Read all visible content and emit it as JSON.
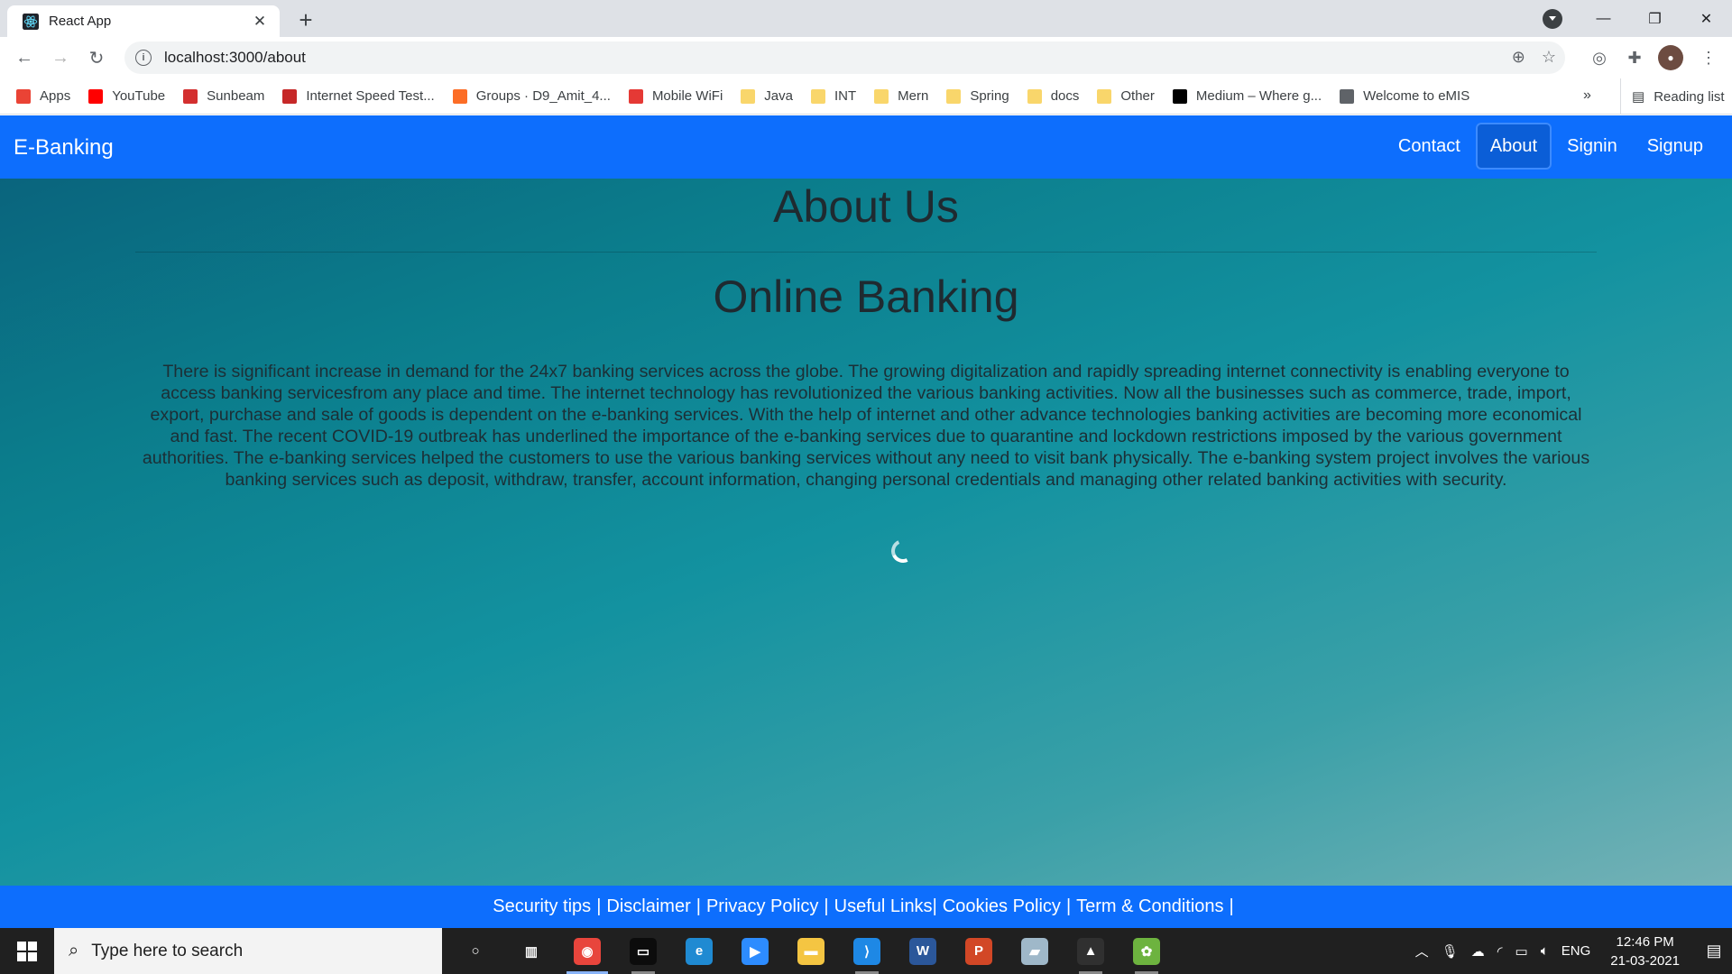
{
  "browser": {
    "tab_title": "React App",
    "url": "localhost:3000/about",
    "bookmarks": [
      {
        "label": "Apps",
        "color": "#ea4335"
      },
      {
        "label": "YouTube",
        "color": "#ff0000"
      },
      {
        "label": "Sunbeam",
        "color": "#d32f2f"
      },
      {
        "label": "Internet Speed Test...",
        "color": "#c62828"
      },
      {
        "label": "Groups · D9_Amit_4...",
        "color": "#fc6d26"
      },
      {
        "label": "Mobile WiFi",
        "color": "#e53935"
      },
      {
        "label": "Java",
        "color": "#f9d66b"
      },
      {
        "label": "INT",
        "color": "#f9d66b"
      },
      {
        "label": "Mern",
        "color": "#f9d66b"
      },
      {
        "label": "Spring",
        "color": "#f9d66b"
      },
      {
        "label": "docs",
        "color": "#f9d66b"
      },
      {
        "label": "Other",
        "color": "#f9d66b"
      },
      {
        "label": "Medium – Where g...",
        "color": "#000000"
      },
      {
        "label": "Welcome to eMIS",
        "color": "#5f6368"
      }
    ],
    "bookmarks_more": "»",
    "reading_list": "Reading list"
  },
  "navbar": {
    "brand": "E-Banking",
    "links": [
      {
        "label": "Contact",
        "active": false
      },
      {
        "label": "About",
        "active": true
      },
      {
        "label": "Signin",
        "active": false
      },
      {
        "label": "Signup",
        "active": false
      }
    ]
  },
  "main": {
    "heading": "About Us",
    "subheading": "Online Banking",
    "paragraph": "There is significant increase in demand for the 24x7 banking services across the globe. The growing digitalization and rapidly spreading internet connectivity is enabling everyone to access banking servicesfrom any place and time. The internet technology has revolutionized the various banking activities. Now all the businesses such as commerce, trade, import, export, purchase and sale of goods is dependent on the e-banking services. With the help of internet and other advance technologies banking activities are becoming more economical and fast. The recent COVID-19 outbreak has underlined the importance of the e-banking services due to quarantine and lockdown restrictions imposed by the various government authorities. The e-banking services helped the customers to use the various banking services without any need to visit bank physically. The e-banking system project involves the various banking services such as deposit, withdraw, transfer, account information, changing personal credentials and managing other related banking activities with security."
  },
  "footer": {
    "links": [
      "Security tips",
      "Disclaimer",
      "Privacy Policy",
      "Useful Links",
      "Cookies Policy",
      "Term & Conditions"
    ],
    "separator": "|"
  },
  "taskbar": {
    "search_placeholder": "Type here to search",
    "language": "ENG",
    "time": "12:46 PM",
    "date": "21-03-2021",
    "apps": [
      {
        "name": "cortana-icon",
        "color": "#202020",
        "glyph": "○",
        "state": "none"
      },
      {
        "name": "task-view-icon",
        "color": "#202020",
        "glyph": "▥",
        "state": "none"
      },
      {
        "name": "chrome-icon",
        "color": "#e8453c",
        "glyph": "◉",
        "state": "active"
      },
      {
        "name": "terminal-icon",
        "color": "#0c0c0c",
        "glyph": "▭",
        "state": "running"
      },
      {
        "name": "edge-icon",
        "color": "#1f8ad2",
        "glyph": "e",
        "state": "none"
      },
      {
        "name": "zoom-icon",
        "color": "#2d8cff",
        "glyph": "▶",
        "state": "none"
      },
      {
        "name": "file-explorer-icon",
        "color": "#f4c542",
        "glyph": "▬",
        "state": "none"
      },
      {
        "name": "vscode-icon",
        "color": "#1e88e5",
        "glyph": "⟩",
        "state": "running"
      },
      {
        "name": "word-icon",
        "color": "#2b579a",
        "glyph": "W",
        "state": "none"
      },
      {
        "name": "powerpoint-icon",
        "color": "#d24726",
        "glyph": "P",
        "state": "none"
      },
      {
        "name": "notepad-icon",
        "color": "#9fb8c9",
        "glyph": "▰",
        "state": "none"
      },
      {
        "name": "photos-icon",
        "color": "#303030",
        "glyph": "▲",
        "state": "running"
      },
      {
        "name": "spring-tool-icon",
        "color": "#6db33f",
        "glyph": "✿",
        "state": "running"
      }
    ]
  },
  "colors": {
    "navbar": "#0d6efd",
    "footer": "#0d6efd",
    "active_nav": "#0b5ed7",
    "text_dark": "#1f2a30"
  }
}
